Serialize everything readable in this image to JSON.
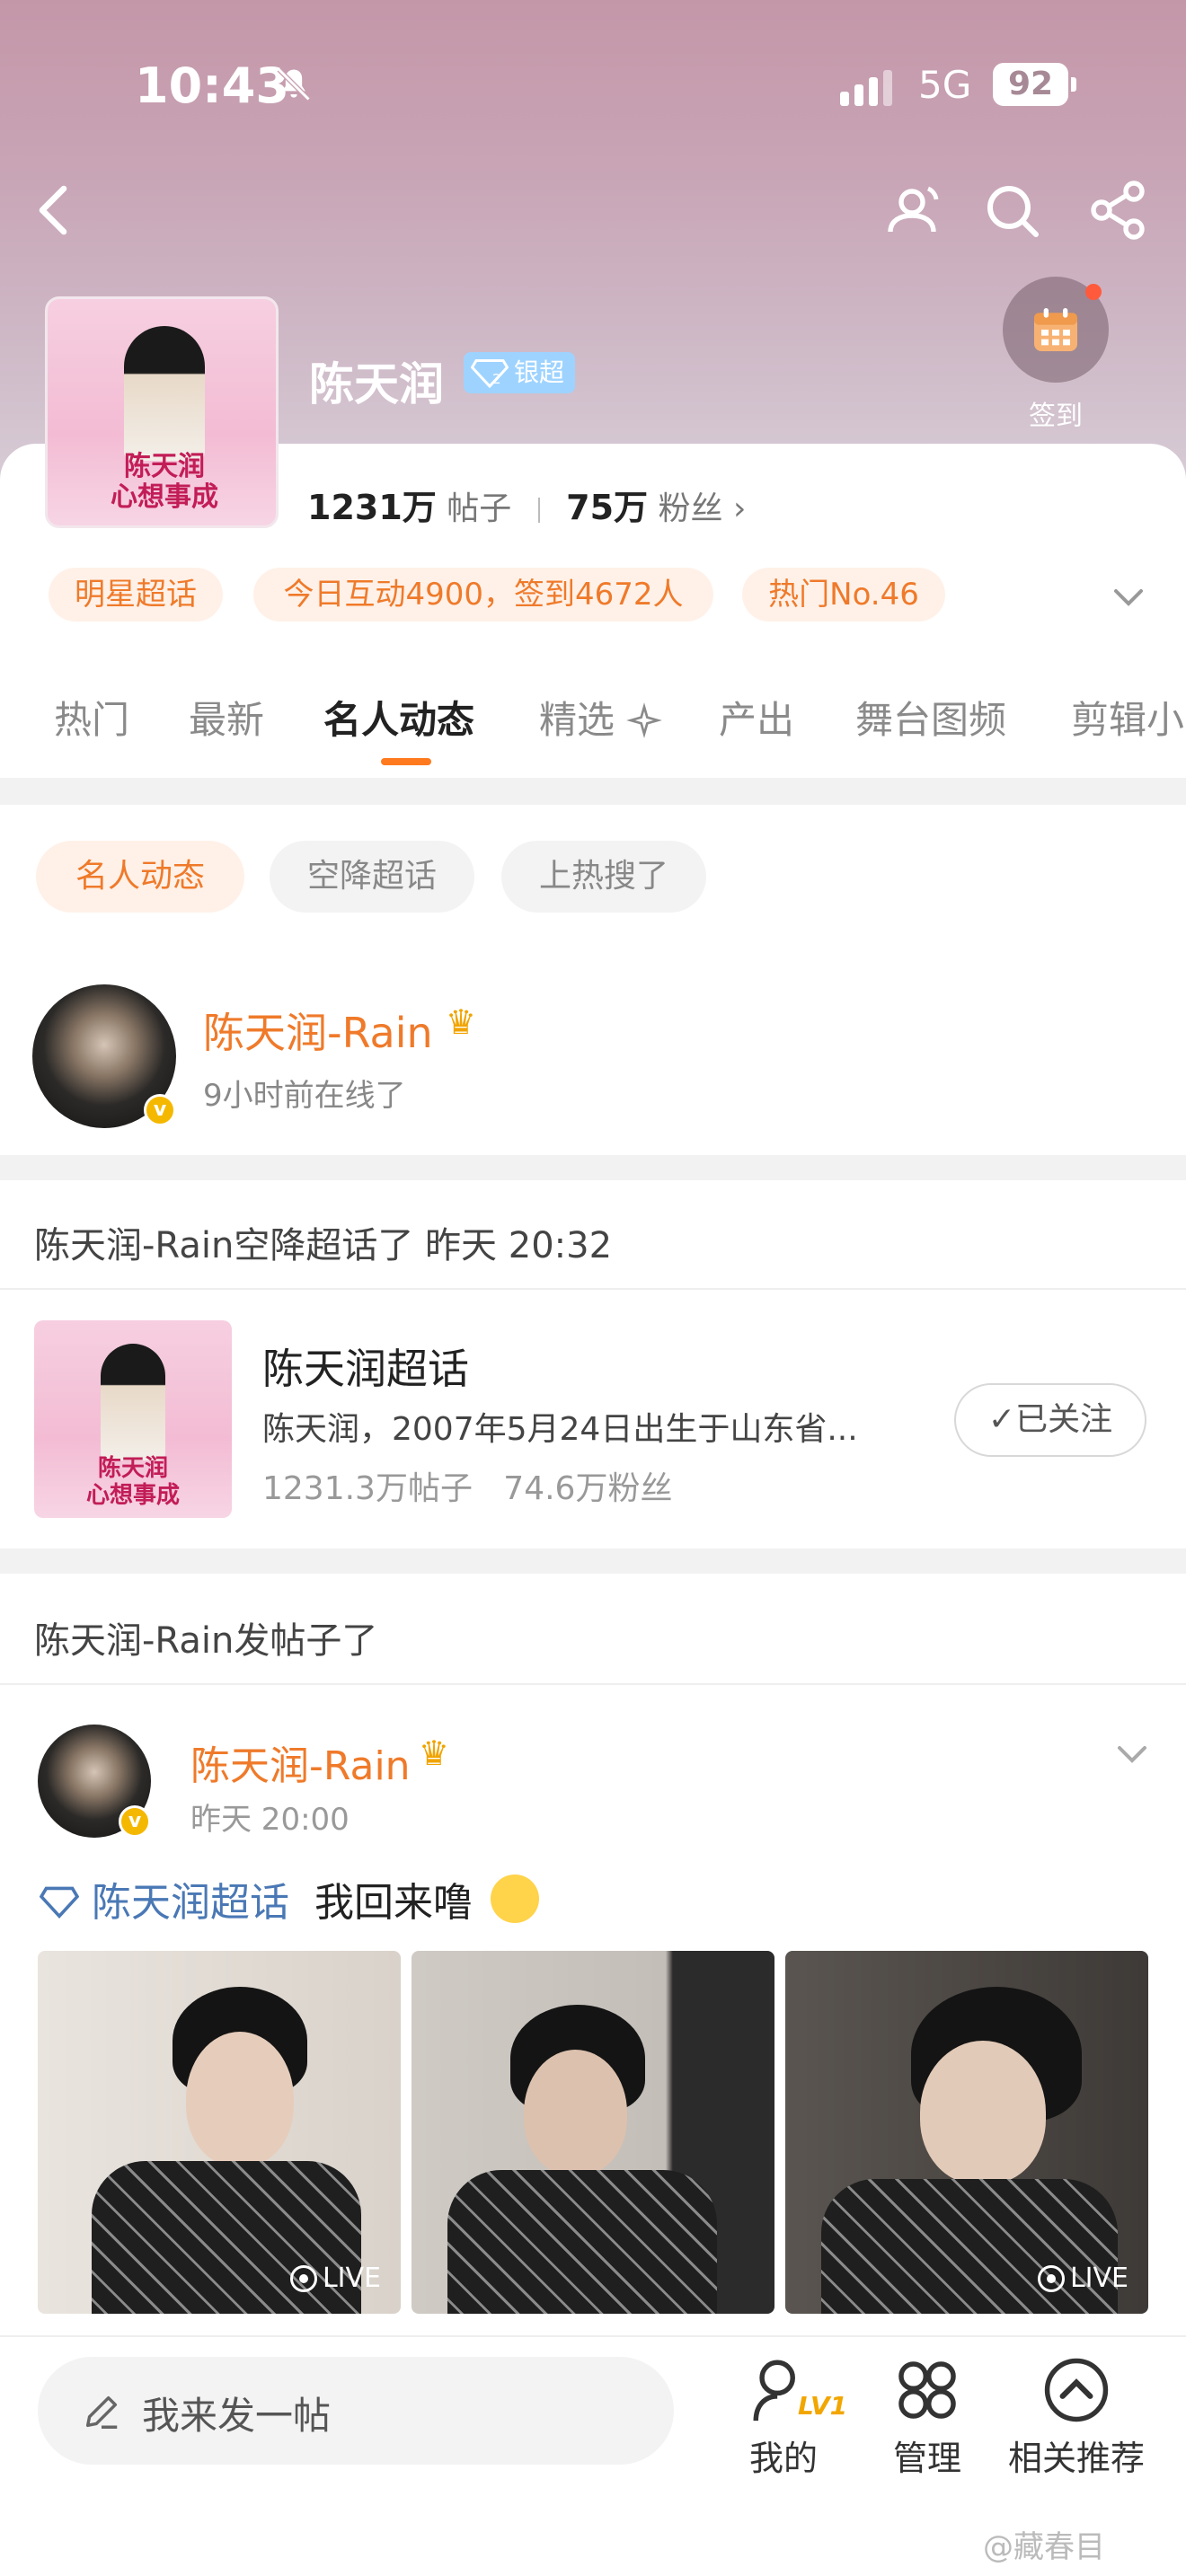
{
  "status_bar": {
    "time": "10:43",
    "network": "5G",
    "battery": "92"
  },
  "header": {
    "group_name": "陈天润",
    "badge_label": "银超",
    "signin_label": "签到",
    "stats": {
      "posts_value": "1231万",
      "posts_label": "帖子",
      "fans_value": "75万",
      "fans_label": "粉丝"
    },
    "avatar_caption": "陈天润\n心想事成"
  },
  "chips": [
    "明星超话",
    "今日互动4900，签到4672人",
    "热门No.46"
  ],
  "tabs": [
    "热门",
    "最新",
    "名人动态",
    "精选",
    "产出",
    "舞台图频",
    "剪辑小"
  ],
  "active_tab": "名人动态",
  "subfilters": [
    "名人动态",
    "空降超话",
    "上热搜了"
  ],
  "celebrity": {
    "name": "陈天润-Rain",
    "online": "9小时前在线了"
  },
  "section_joined": "陈天润-Rain空降超话了 昨天 20:32",
  "topic": {
    "title": "陈天润超话",
    "description": "陈天润，2007年5月24日出生于山东省...",
    "stats": "1231.3万帖子   74.6万粉丝",
    "follow_label": "已关注",
    "thumb_caption": "陈天润\n心想事成"
  },
  "section_posted": "陈天润-Rain发帖子了",
  "post": {
    "author": "陈天润-Rain",
    "time": "昨天 20:00",
    "topic_link": "陈天润超话",
    "text": "我回来噜",
    "live_label": "LIVE"
  },
  "bottom_bar": {
    "compose_placeholder": "我来发一帖",
    "mine": "我的",
    "level": "LV1",
    "manage": "管理",
    "related": "相关推荐"
  },
  "watermark": "@藏春目"
}
